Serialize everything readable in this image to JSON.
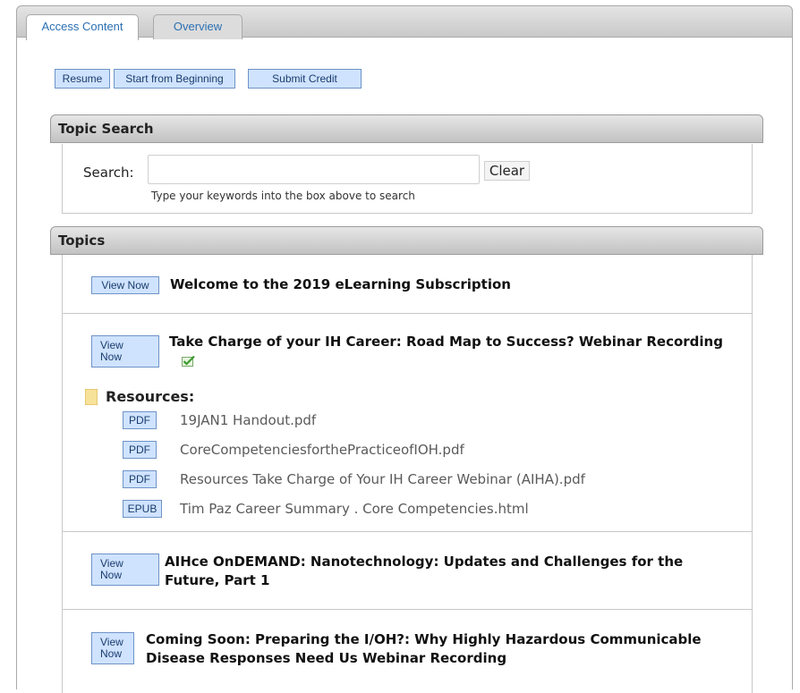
{
  "tabs": [
    {
      "label": "Access Content",
      "active": true
    },
    {
      "label": "Overview",
      "active": false
    }
  ],
  "actions": {
    "resume": "Resume",
    "start_from_beginning": "Start from Beginning",
    "submit_credit": "Submit Credit"
  },
  "topic_search": {
    "title": "Topic Search",
    "label": "Search:",
    "value": "",
    "clear": "Clear",
    "hint": "Type your keywords into the box above to search"
  },
  "topics_section": {
    "title": "Topics",
    "items": [
      {
        "button": "View Now",
        "title": "Welcome to the 2019 eLearning Subscription"
      },
      {
        "button": "View\nNow",
        "title": "Take Charge of your IH Career: Road Map to Success? Webinar Recording",
        "completed": true
      },
      {
        "button": "View\nNow",
        "title": "AIHce OnDEMAND: Nanotechnology: Updates and Challenges for the Future, Part 1"
      },
      {
        "button": "View\nNow",
        "title": "Coming Soon: Preparing the I/OH?: Why Highly Hazardous Communicable Disease Responses Need Us Webinar Recording"
      }
    ],
    "resources": {
      "label": "Resources:",
      "files": [
        {
          "type": "PDF",
          "name": "19JAN1 Handout.pdf"
        },
        {
          "type": "PDF",
          "name": "CoreCompetenciesforthePracticeofIOH.pdf"
        },
        {
          "type": "PDF",
          "name": "Resources Take Charge of Your IH Career Webinar (AIHA).pdf"
        },
        {
          "type": "EPUB",
          "name": "Tim Paz Career Summary . Core Competencies.html"
        }
      ]
    }
  },
  "icons": {
    "completed": "check-icon",
    "resources": "folder-icon"
  },
  "colors": {
    "button_bg": "#cfe3ff",
    "button_border": "#6e93c8",
    "tab_text": "#2b6fb3"
  }
}
